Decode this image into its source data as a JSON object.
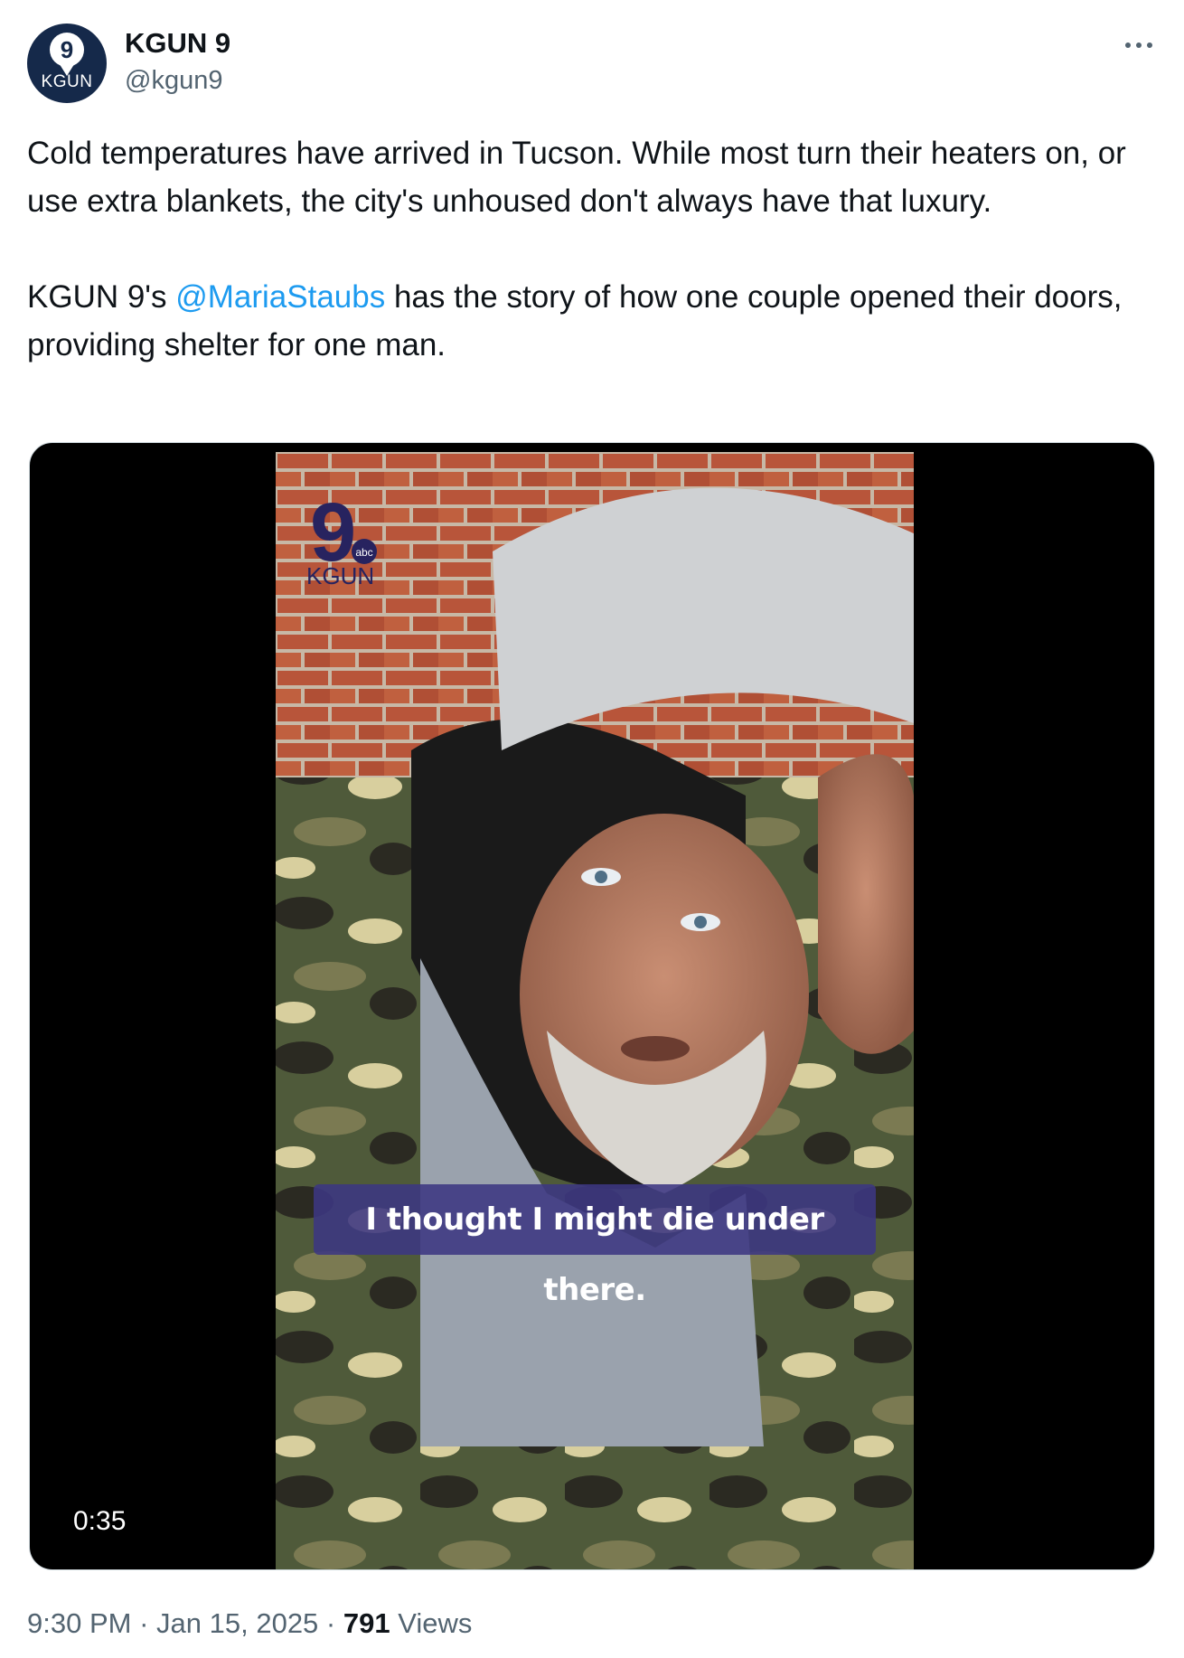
{
  "author": {
    "display_name": "KGUN 9",
    "handle": "@kgun9",
    "avatar_text": "KGUN",
    "avatar_number": "9"
  },
  "more_icon": "more-horizontal-icon",
  "tweet": {
    "paragraph_1": "Cold temperatures have arrived in Tucson. While most turn their heaters on, or use extra blankets, the city's unhoused don't always have that luxury.",
    "paragraph_2_prefix": "KGUN 9's ",
    "mention": "@MariaStaubs",
    "paragraph_2_suffix": " has the story of how one couple opened their doors, providing shelter for one man."
  },
  "video": {
    "watermark_number": "9",
    "watermark_badge": "abc",
    "watermark_text": "KGUN",
    "caption": "I thought I might die under there.",
    "duration": "0:35"
  },
  "meta": {
    "time": "9:30 PM",
    "separator": "·",
    "date": "Jan 15, 2025",
    "views_count": "791",
    "views_label": "Views"
  },
  "colors": {
    "accent": "#1d9bf0",
    "caption_bg": "#3c3782"
  }
}
